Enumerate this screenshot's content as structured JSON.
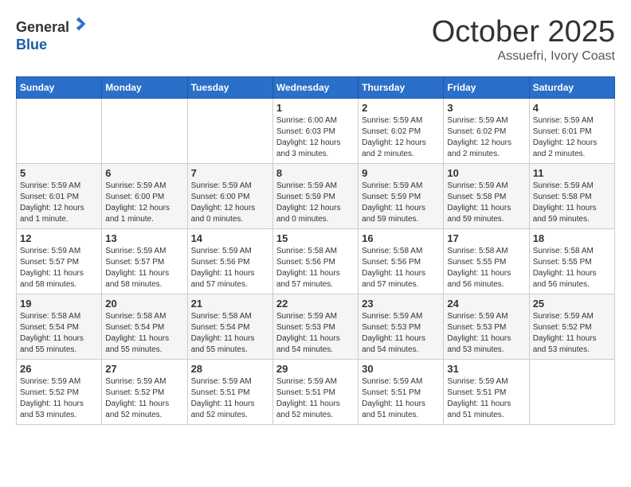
{
  "header": {
    "logo_line1": "General",
    "logo_line2": "Blue",
    "month": "October 2025",
    "location": "Assuefri, Ivory Coast"
  },
  "weekdays": [
    "Sunday",
    "Monday",
    "Tuesday",
    "Wednesday",
    "Thursday",
    "Friday",
    "Saturday"
  ],
  "weeks": [
    [
      {
        "day": "",
        "content": ""
      },
      {
        "day": "",
        "content": ""
      },
      {
        "day": "",
        "content": ""
      },
      {
        "day": "1",
        "content": "Sunrise: 6:00 AM\nSunset: 6:03 PM\nDaylight: 12 hours\nand 3 minutes."
      },
      {
        "day": "2",
        "content": "Sunrise: 5:59 AM\nSunset: 6:02 PM\nDaylight: 12 hours\nand 2 minutes."
      },
      {
        "day": "3",
        "content": "Sunrise: 5:59 AM\nSunset: 6:02 PM\nDaylight: 12 hours\nand 2 minutes."
      },
      {
        "day": "4",
        "content": "Sunrise: 5:59 AM\nSunset: 6:01 PM\nDaylight: 12 hours\nand 2 minutes."
      }
    ],
    [
      {
        "day": "5",
        "content": "Sunrise: 5:59 AM\nSunset: 6:01 PM\nDaylight: 12 hours\nand 1 minute."
      },
      {
        "day": "6",
        "content": "Sunrise: 5:59 AM\nSunset: 6:00 PM\nDaylight: 12 hours\nand 1 minute."
      },
      {
        "day": "7",
        "content": "Sunrise: 5:59 AM\nSunset: 6:00 PM\nDaylight: 12 hours\nand 0 minutes."
      },
      {
        "day": "8",
        "content": "Sunrise: 5:59 AM\nSunset: 5:59 PM\nDaylight: 12 hours\nand 0 minutes."
      },
      {
        "day": "9",
        "content": "Sunrise: 5:59 AM\nSunset: 5:59 PM\nDaylight: 11 hours\nand 59 minutes."
      },
      {
        "day": "10",
        "content": "Sunrise: 5:59 AM\nSunset: 5:58 PM\nDaylight: 11 hours\nand 59 minutes."
      },
      {
        "day": "11",
        "content": "Sunrise: 5:59 AM\nSunset: 5:58 PM\nDaylight: 11 hours\nand 59 minutes."
      }
    ],
    [
      {
        "day": "12",
        "content": "Sunrise: 5:59 AM\nSunset: 5:57 PM\nDaylight: 11 hours\nand 58 minutes."
      },
      {
        "day": "13",
        "content": "Sunrise: 5:59 AM\nSunset: 5:57 PM\nDaylight: 11 hours\nand 58 minutes."
      },
      {
        "day": "14",
        "content": "Sunrise: 5:59 AM\nSunset: 5:56 PM\nDaylight: 11 hours\nand 57 minutes."
      },
      {
        "day": "15",
        "content": "Sunrise: 5:58 AM\nSunset: 5:56 PM\nDaylight: 11 hours\nand 57 minutes."
      },
      {
        "day": "16",
        "content": "Sunrise: 5:58 AM\nSunset: 5:56 PM\nDaylight: 11 hours\nand 57 minutes."
      },
      {
        "day": "17",
        "content": "Sunrise: 5:58 AM\nSunset: 5:55 PM\nDaylight: 11 hours\nand 56 minutes."
      },
      {
        "day": "18",
        "content": "Sunrise: 5:58 AM\nSunset: 5:55 PM\nDaylight: 11 hours\nand 56 minutes."
      }
    ],
    [
      {
        "day": "19",
        "content": "Sunrise: 5:58 AM\nSunset: 5:54 PM\nDaylight: 11 hours\nand 55 minutes."
      },
      {
        "day": "20",
        "content": "Sunrise: 5:58 AM\nSunset: 5:54 PM\nDaylight: 11 hours\nand 55 minutes."
      },
      {
        "day": "21",
        "content": "Sunrise: 5:58 AM\nSunset: 5:54 PM\nDaylight: 11 hours\nand 55 minutes."
      },
      {
        "day": "22",
        "content": "Sunrise: 5:59 AM\nSunset: 5:53 PM\nDaylight: 11 hours\nand 54 minutes."
      },
      {
        "day": "23",
        "content": "Sunrise: 5:59 AM\nSunset: 5:53 PM\nDaylight: 11 hours\nand 54 minutes."
      },
      {
        "day": "24",
        "content": "Sunrise: 5:59 AM\nSunset: 5:53 PM\nDaylight: 11 hours\nand 53 minutes."
      },
      {
        "day": "25",
        "content": "Sunrise: 5:59 AM\nSunset: 5:52 PM\nDaylight: 11 hours\nand 53 minutes."
      }
    ],
    [
      {
        "day": "26",
        "content": "Sunrise: 5:59 AM\nSunset: 5:52 PM\nDaylight: 11 hours\nand 53 minutes."
      },
      {
        "day": "27",
        "content": "Sunrise: 5:59 AM\nSunset: 5:52 PM\nDaylight: 11 hours\nand 52 minutes."
      },
      {
        "day": "28",
        "content": "Sunrise: 5:59 AM\nSunset: 5:51 PM\nDaylight: 11 hours\nand 52 minutes."
      },
      {
        "day": "29",
        "content": "Sunrise: 5:59 AM\nSunset: 5:51 PM\nDaylight: 11 hours\nand 52 minutes."
      },
      {
        "day": "30",
        "content": "Sunrise: 5:59 AM\nSunset: 5:51 PM\nDaylight: 11 hours\nand 51 minutes."
      },
      {
        "day": "31",
        "content": "Sunrise: 5:59 AM\nSunset: 5:51 PM\nDaylight: 11 hours\nand 51 minutes."
      },
      {
        "day": "",
        "content": ""
      }
    ]
  ]
}
